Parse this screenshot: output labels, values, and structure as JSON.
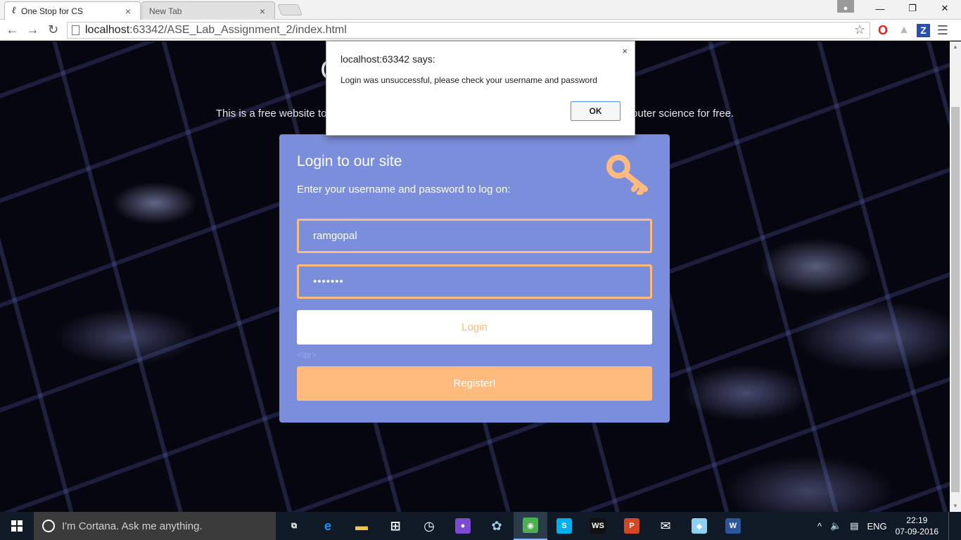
{
  "browser": {
    "tabs": [
      {
        "favicon": "ℓ",
        "title": "One Stop for CS",
        "close": "×"
      },
      {
        "title": "New Tab",
        "close": "×"
      }
    ],
    "window_controls": {
      "minimize": "—",
      "restore": "❐",
      "close": "✕"
    },
    "nav": {
      "back": "←",
      "forward": "→",
      "reload": "↻"
    },
    "url": {
      "host": "localhost",
      "path": ":63342/ASE_Lab_Assignment_2/index.html"
    },
    "bookmark_star": "☆",
    "extensions": {
      "opera": "O",
      "drive": "▲",
      "z": "Z",
      "menu": "☰"
    }
  },
  "page": {
    "hero_title": "One Stop Resource Place",
    "hero_text": "This is a free website to learn computer science. Create an account and learn all the computer science for free.",
    "login": {
      "title": "Login to our site",
      "subtitle": "Enter your username and password to log on:",
      "username_value": "ramgopal",
      "password_value": "•••••••",
      "login_button": "Login",
      "br_text": "<\\br>",
      "register_button": "Register!"
    }
  },
  "dialog": {
    "title": "localhost:63342 says:",
    "message": "Login was unsuccessful, please check your username and password",
    "ok_button": "OK",
    "close": "×"
  },
  "taskbar": {
    "cortana_placeholder": "I'm Cortana. Ask me anything.",
    "apps": [
      {
        "name": "task-view",
        "glyph": "⧉"
      },
      {
        "name": "edge",
        "glyph": "e",
        "color": "#1e90ff"
      },
      {
        "name": "file-explorer",
        "glyph": "▬",
        "color": "#f6c343"
      },
      {
        "name": "store",
        "glyph": "⊞",
        "color": "#ffffff"
      },
      {
        "name": "clock-app",
        "glyph": "◷",
        "color": "#ffffff"
      },
      {
        "name": "app-purple",
        "glyph": "●",
        "color": "#7a4bd0"
      },
      {
        "name": "app-teal",
        "glyph": "✿",
        "color": "#9ecae1"
      },
      {
        "name": "chrome",
        "glyph": "◉",
        "color": "#4caf50"
      },
      {
        "name": "skype",
        "glyph": "S",
        "color": "#00aff0"
      },
      {
        "name": "webstorm",
        "glyph": "WS",
        "color": "#111111"
      },
      {
        "name": "powerpoint",
        "glyph": "P",
        "color": "#d24726"
      },
      {
        "name": "mail",
        "glyph": "✉",
        "color": "#ffffff"
      },
      {
        "name": "app-glass",
        "glyph": "◆",
        "color": "#8fd0f0"
      },
      {
        "name": "word",
        "glyph": "W",
        "color": "#2b579a"
      }
    ],
    "tray": {
      "chevron": "^",
      "volume": "🔈",
      "notification": "▤",
      "language": "ENG",
      "time": "22:19",
      "date": "07-09-2016"
    }
  },
  "colors": {
    "form_bg": "#7b8edb",
    "accent_orange": "#ffbb7d",
    "dialog_ok_border": "#4d90fe"
  }
}
